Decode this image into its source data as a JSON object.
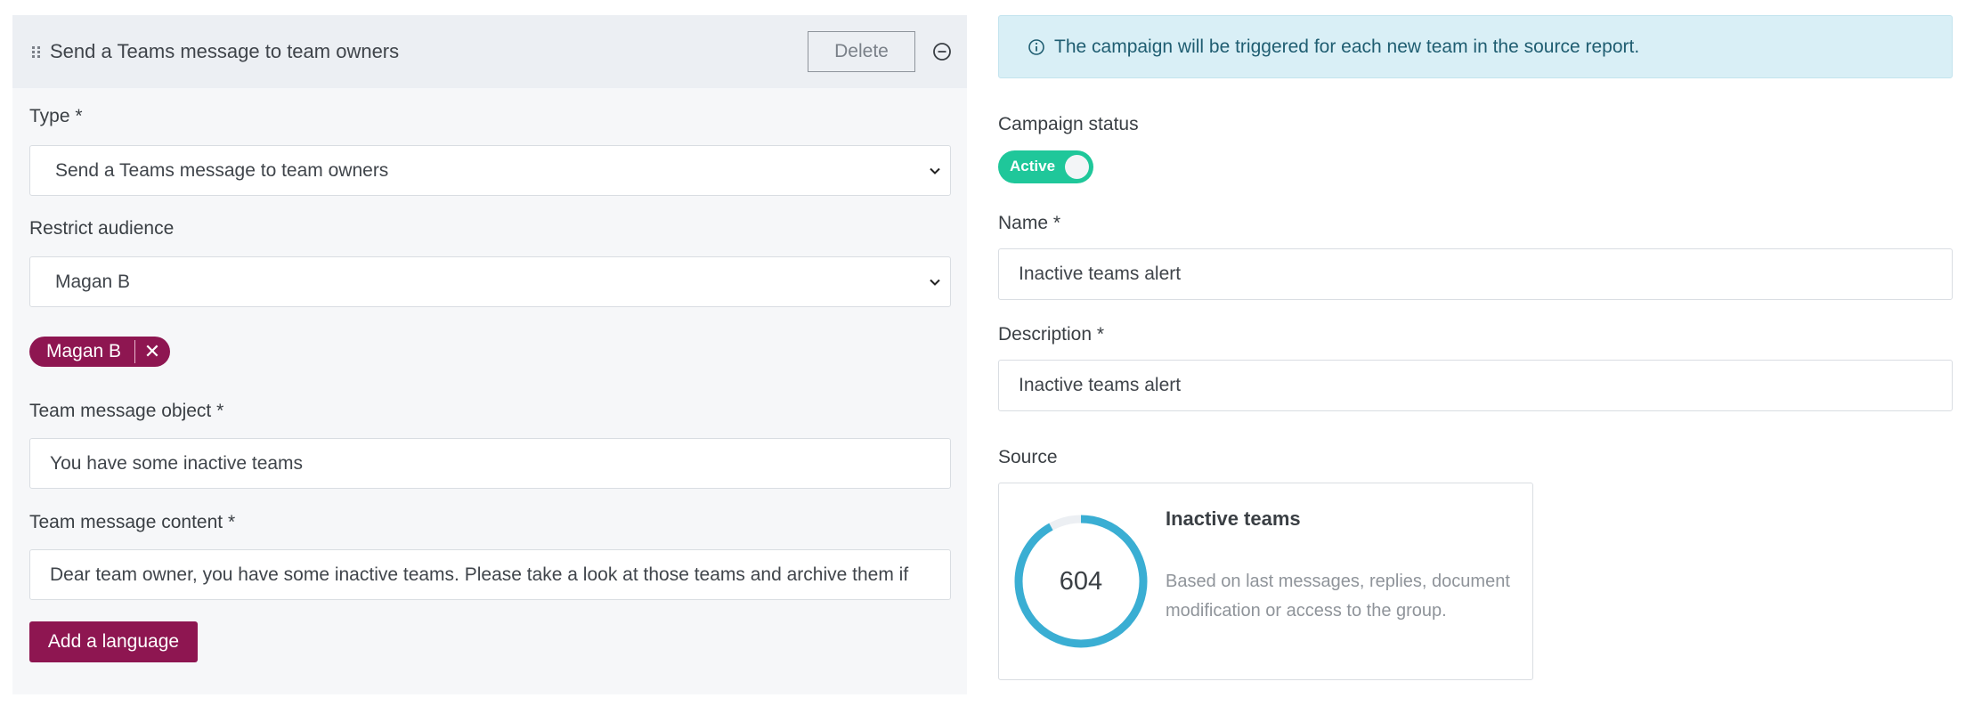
{
  "step": {
    "title": "Send a Teams message to team owners",
    "delete_label": "Delete"
  },
  "form": {
    "type_label": "Type *",
    "type_value": "Send a Teams message to team owners",
    "audience_label": "Restrict audience",
    "audience_value": "Magan B",
    "audience_tags": [
      "Magan B"
    ],
    "object_label": "Team message object *",
    "object_value": "You have some inactive teams",
    "content_label": "Team message content *",
    "content_value": "Dear team owner, you have some inactive teams. Please take a look at those teams and archive them if",
    "add_language_label": "Add a language"
  },
  "info": {
    "text": "The campaign will be triggered for each new team in the source report."
  },
  "campaign": {
    "status_label": "Campaign status",
    "status_value": "Active",
    "name_label": "Name *",
    "name_value": "Inactive teams alert",
    "description_label": "Description *",
    "description_value": "Inactive teams alert",
    "source_label": "Source"
  },
  "source_card": {
    "count": "604",
    "title": "Inactive teams",
    "description": "Based on last messages, replies, document modification or access to the group.",
    "ring_fill_fraction": 0.92,
    "ring_color": "#3aaed3",
    "ring_track_color": "#eceff3"
  },
  "colors": {
    "brand": "#8e1651",
    "toggle_active": "#1fc79a",
    "info_bg": "#d9eff6",
    "info_text": "#1f5d71"
  },
  "icons": {
    "drag": "drag-handle-icon",
    "collapse": "minus-circle-icon",
    "chevron": "chevron-down-icon",
    "info": "info-circle-icon",
    "remove": "close-icon"
  }
}
